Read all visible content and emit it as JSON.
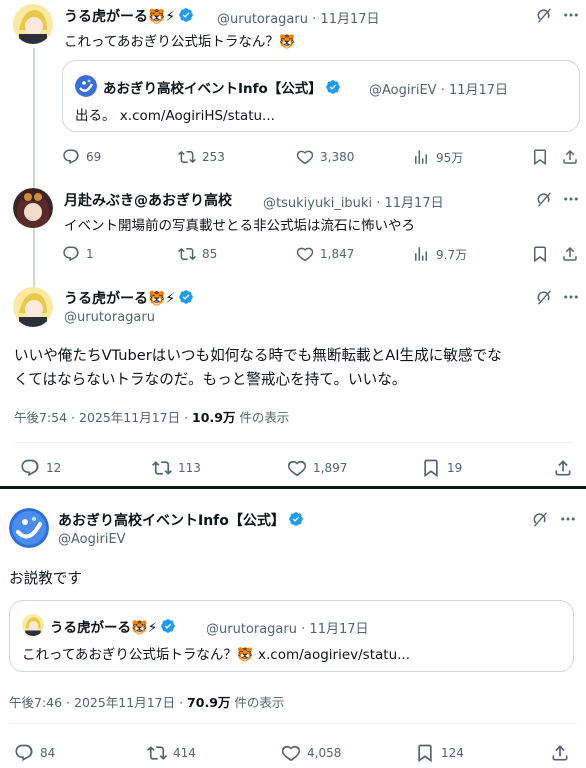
{
  "tweet1": {
    "name": "うる虎がーる🐯⚡",
    "handle": "@urutoragaru",
    "time": "11月17日",
    "text": "これってあおぎり公式垢トラなん？🐯",
    "quote": {
      "name": "あおぎり高校イベントInfo【公式】",
      "handle": "@AogiriEV",
      "time": "11月17日",
      "text": "出る。 x.com/AogiriHS/statu..."
    },
    "replies": "69",
    "reposts": "253",
    "likes": "3,380",
    "views": "95万"
  },
  "tweet2": {
    "name": "月赴みぶき@あおぎり高校",
    "handle": "@tsukiyuki_ibuki",
    "time": "11月17日",
    "text": "イベント開場前の写真載せとる非公式垢は流石に怖いやろ",
    "replies": "1",
    "reposts": "85",
    "likes": "1,847",
    "views": "9.7万"
  },
  "main": {
    "name": "うる虎がーる🐯⚡",
    "handle": "@urutoragaru",
    "text1": "いいや俺たちVTuberはいつも如何なる時でも無断転載とAI生成に敏感でな",
    "text2": "くてはならないトラなのだ。もっと警戒心を持て。いいな。",
    "timestamp": "午後7:54 · 2025年11月17日 · ",
    "views_count": "10.9万",
    "views_label": " 件の表示",
    "replies": "12",
    "reposts": "113",
    "likes": "1,897",
    "bookmarks": "19"
  },
  "second": {
    "name": "あおぎり高校イベントInfo【公式】",
    "handle": "@AogiriEV",
    "text": "お説教です",
    "quote": {
      "name": "うる虎がーる🐯⚡",
      "handle": "@urutoragaru",
      "time": "11月17日",
      "text": "これってあおぎり公式垢トラなん？🐯 x.com/aogiriev/statu..."
    },
    "timestamp": "午後7:46 · 2025年11月17日 · ",
    "views_count": "70.9万",
    "views_label": " 件の表示",
    "replies": "84",
    "reposts": "414",
    "likes": "4,058",
    "bookmarks": "124"
  },
  "separator": "·",
  "colors": {
    "accent": "#1d9bf0",
    "text": "#0f1419",
    "muted": "#536471",
    "border": "#cfd9de"
  }
}
